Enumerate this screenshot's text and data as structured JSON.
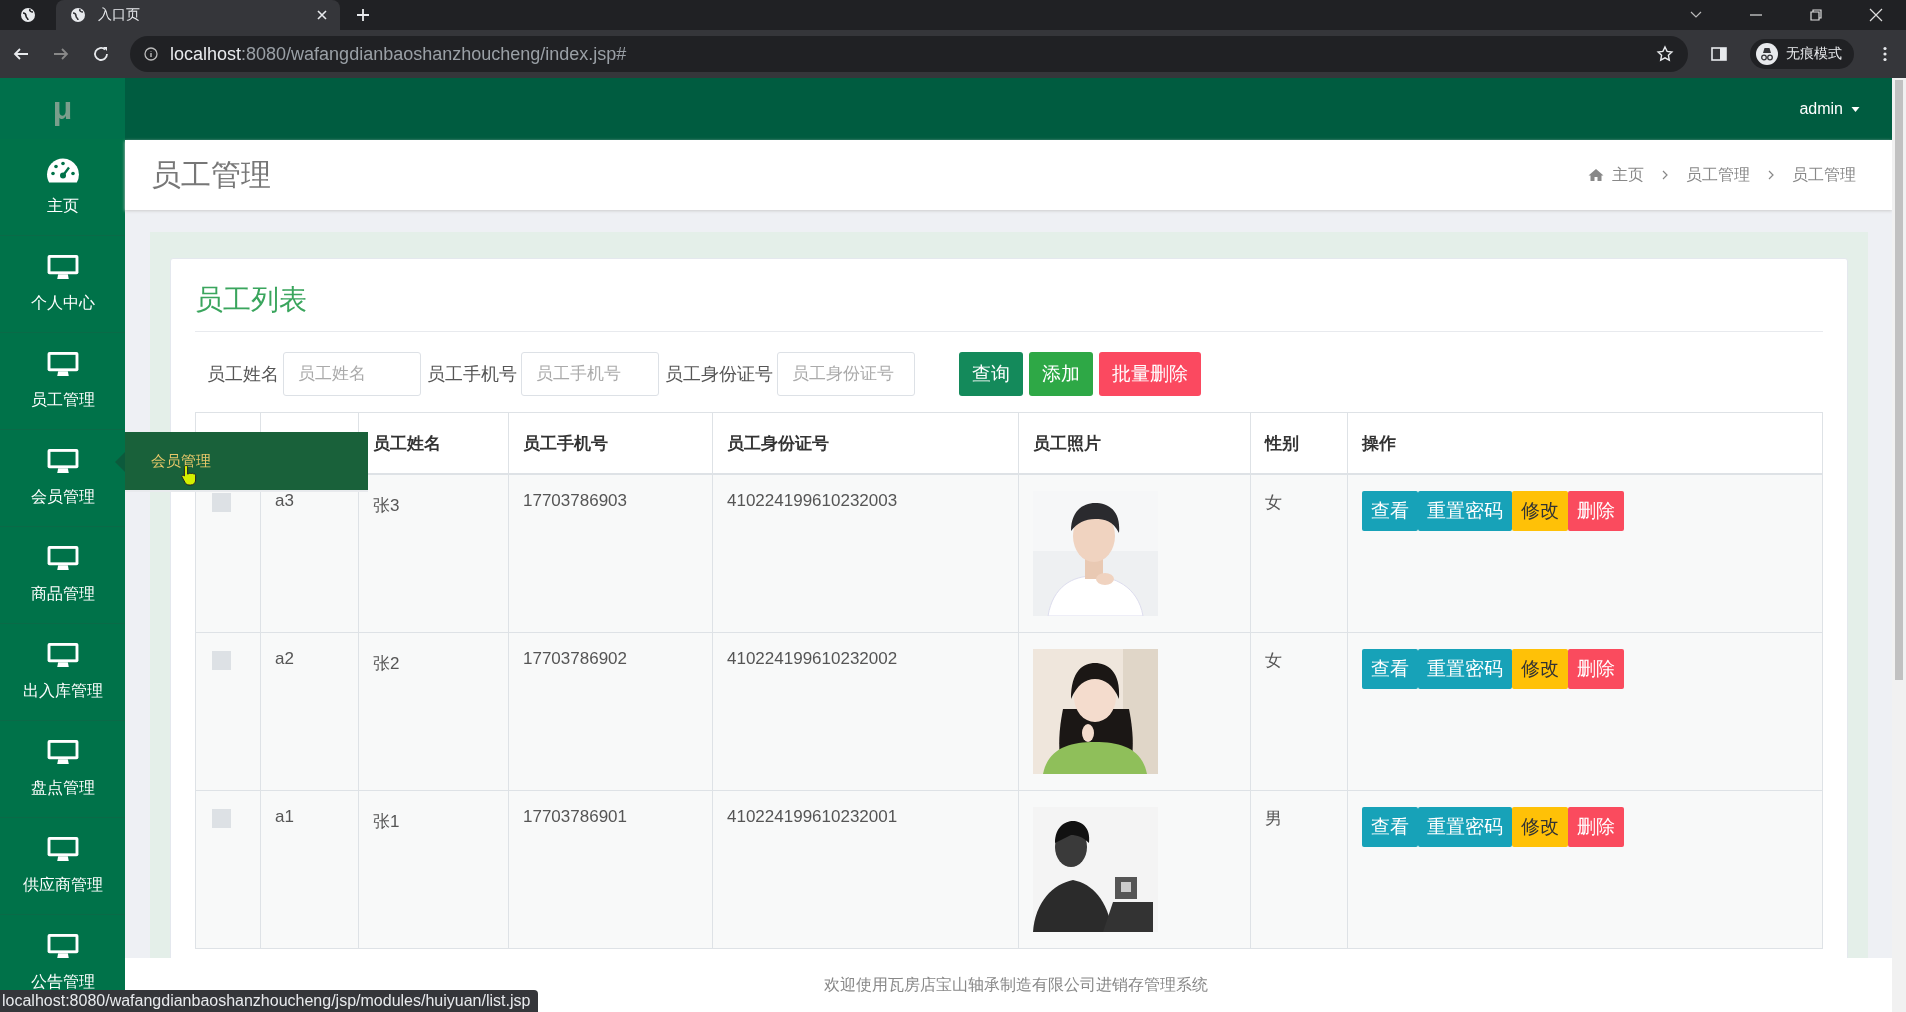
{
  "browser": {
    "tabs": [
      {
        "title": "入口页",
        "selected": true
      }
    ],
    "url_host": "localhost",
    "url_rest": ":8080/wafangdianbaoshanzhoucheng/index.jsp#",
    "incognito_label": "无痕模式"
  },
  "header": {
    "logo": "μ",
    "user": "admin"
  },
  "sidebar": {
    "items": [
      {
        "label": "主页",
        "kind": "dashboard",
        "hovered": false
      },
      {
        "label": "个人中心",
        "kind": "monitor",
        "hovered": false
      },
      {
        "label": "员工管理",
        "kind": "monitor",
        "hovered": false
      },
      {
        "label": "会员管理",
        "kind": "monitor",
        "hovered": true
      },
      {
        "label": "商品管理",
        "kind": "monitor",
        "hovered": false
      },
      {
        "label": "出入库管理",
        "kind": "monitor",
        "hovered": false
      },
      {
        "label": "盘点管理",
        "kind": "monitor",
        "hovered": false
      },
      {
        "label": "供应商管理",
        "kind": "monitor",
        "hovered": false
      },
      {
        "label": "公告管理",
        "kind": "monitor",
        "hovered": false
      }
    ],
    "flyout": {
      "label": "会员管理"
    }
  },
  "page_title": "员工管理",
  "breadcrumb": [
    "主页",
    "员工管理",
    "员工管理"
  ],
  "card_title": "员工列表",
  "filters": [
    {
      "label": "员工姓名",
      "placeholder": "员工姓名"
    },
    {
      "label": "员工手机号",
      "placeholder": "员工手机号"
    },
    {
      "label": "员工身份证号",
      "placeholder": "员工身份证号"
    }
  ],
  "buttons": [
    {
      "label": "查询",
      "kind": "search"
    },
    {
      "label": "添加",
      "kind": "add"
    },
    {
      "label": "批量删除",
      "kind": "delete"
    }
  ],
  "table": {
    "columns": [
      "员工姓名",
      "员工手机号",
      "员工身份证号",
      "员工照片",
      "性别",
      "操作"
    ],
    "rows": [
      {
        "checked": false,
        "column_2": "a3",
        "name": "张3",
        "phone": "17703786903",
        "id_number": "410224199610232003",
        "gender": "女",
        "actions": [
          {
            "label": "查看",
            "kind": "view"
          },
          {
            "label": "重置密码",
            "kind": "reset"
          },
          {
            "label": "修改",
            "kind": "edit"
          },
          {
            "label": "删除",
            "kind": "delete"
          }
        ]
      },
      {
        "checked": false,
        "column_2": "a2",
        "name": "张2",
        "phone": "17703786902",
        "id_number": "410224199610232002",
        "gender": "女",
        "actions": [
          {
            "label": "查看",
            "kind": "view"
          },
          {
            "label": "重置密码",
            "kind": "reset"
          },
          {
            "label": "修改",
            "kind": "edit"
          },
          {
            "label": "删除",
            "kind": "delete"
          }
        ]
      },
      {
        "checked": false,
        "column_2": "a1",
        "name": "张1",
        "phone": "17703786901",
        "id_number": "410224199610232001",
        "gender": "男",
        "actions": [
          {
            "label": "查看",
            "kind": "view"
          },
          {
            "label": "重置密码",
            "kind": "reset"
          },
          {
            "label": "修改",
            "kind": "edit"
          },
          {
            "label": "删除",
            "kind": "delete"
          }
        ]
      }
    ]
  },
  "footer": "欢迎使用瓦房店宝山轴承制造有限公司进销存管理系统",
  "status_url": "localhost:8080/wafangdianbaoshanzhoucheng/jsp/modules/huiyuan/list.jsp"
}
